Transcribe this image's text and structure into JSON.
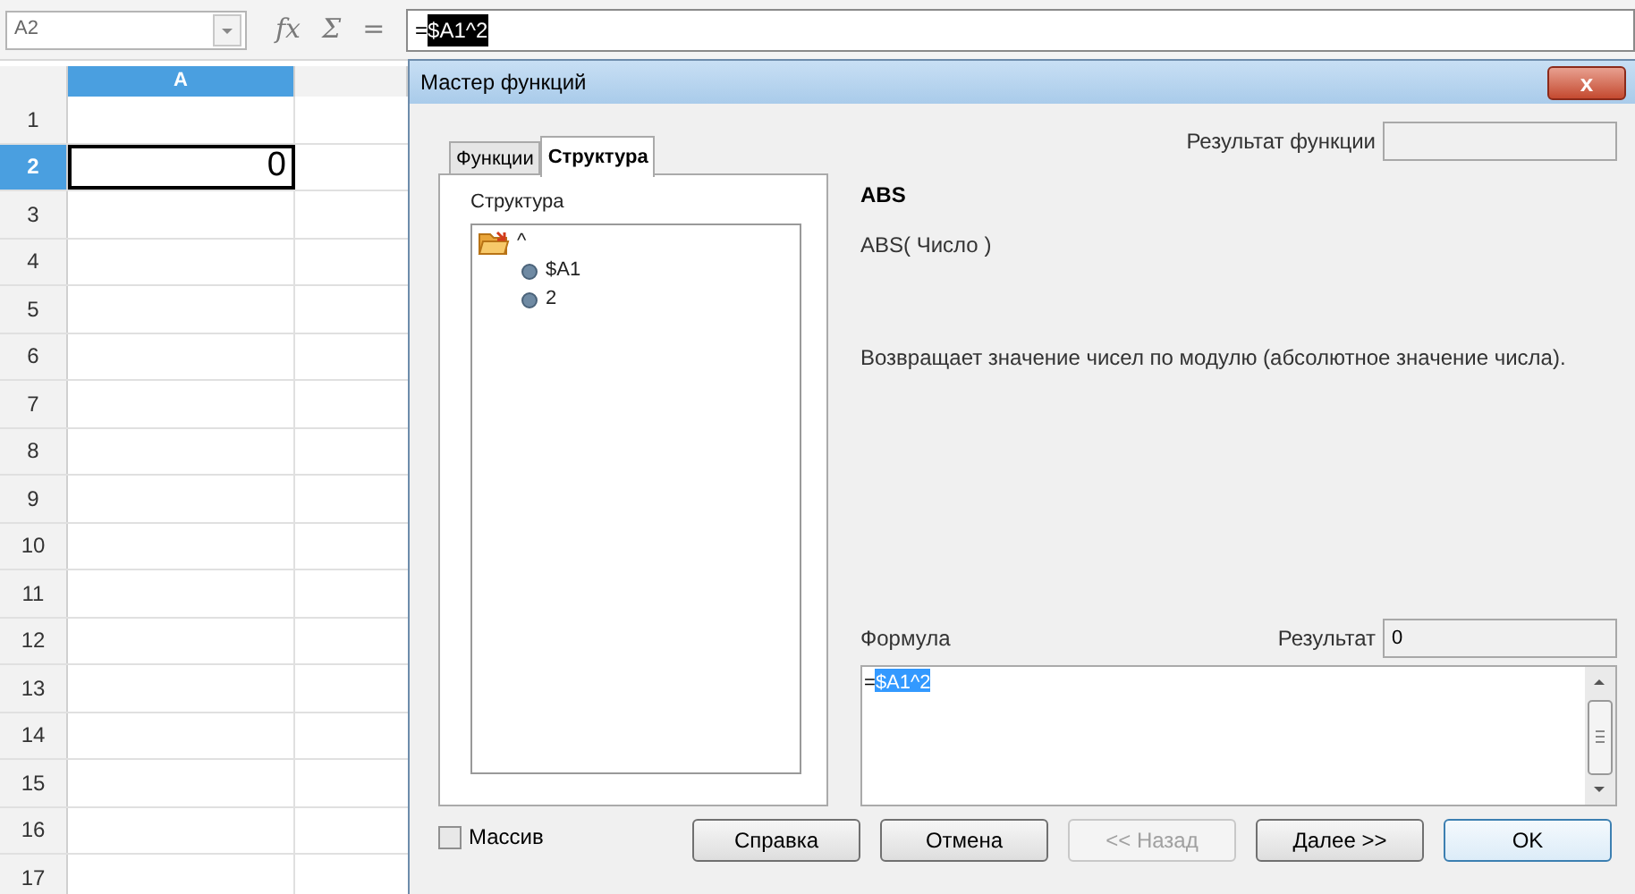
{
  "toolbar": {
    "name_box": "A2",
    "buttons": [
      {
        "label": "fx",
        "disabled": true
      },
      {
        "label": "Σ",
        "disabled": true
      },
      {
        "label": "=",
        "disabled": true
      }
    ],
    "formula_prefix": "=",
    "formula_selection": "$A1^2"
  },
  "sheet": {
    "columns": [
      {
        "label": "A",
        "selected": true
      },
      {
        "selected": false
      }
    ],
    "rows": [
      {
        "label": "1",
        "selected": false,
        "value": ""
      },
      {
        "label": "2",
        "selected": true,
        "value": "0"
      },
      {
        "label": "3",
        "selected": false,
        "value": ""
      },
      {
        "label": "4",
        "selected": false,
        "value": ""
      },
      {
        "label": "5",
        "selected": false,
        "value": ""
      },
      {
        "label": "6",
        "selected": false,
        "value": ""
      },
      {
        "label": "7",
        "selected": false,
        "value": ""
      },
      {
        "label": "8",
        "selected": false,
        "value": ""
      },
      {
        "label": "9",
        "selected": false,
        "value": ""
      },
      {
        "label": "10",
        "selected": false,
        "value": ""
      },
      {
        "label": "11",
        "selected": false,
        "value": ""
      },
      {
        "label": "12",
        "selected": false,
        "value": ""
      },
      {
        "label": "13",
        "selected": false,
        "value": ""
      },
      {
        "label": "14",
        "selected": false,
        "value": ""
      },
      {
        "label": "15",
        "selected": false,
        "value": ""
      },
      {
        "label": "16",
        "selected": false,
        "value": ""
      },
      {
        "label": "17",
        "selected": false,
        "value": ""
      }
    ]
  },
  "dialog": {
    "title": "Мастер функций",
    "close": "x",
    "tabs": [
      {
        "label": "Функции",
        "selected": false
      },
      {
        "label": "Структура",
        "selected": true
      }
    ],
    "structure_label": "Структура",
    "tree": [
      {
        "label": "^",
        "kind": "folder",
        "children": [
          {
            "label": "$A1",
            "kind": "leaf"
          },
          {
            "label": "2",
            "kind": "leaf"
          }
        ]
      }
    ],
    "function_result_label": "Результат функции",
    "function_name": "ABS",
    "function_signature": "ABS( Число )",
    "function_description": "Возвращает значение чисел по модулю (абсолютное значение числа).",
    "formula_label": "Формула",
    "result_label": "Результат",
    "result": "0",
    "formula_prefix": "=",
    "formula_selection": "$A1^2",
    "array_checkbox": {
      "label": "Массив",
      "checked": false
    },
    "buttons": [
      {
        "label": "Справка",
        "disabled": false,
        "default": false
      },
      {
        "label": "Отмена",
        "disabled": false,
        "default": false
      },
      {
        "label": "<< Назад",
        "disabled": true,
        "default": false
      },
      {
        "label": "Далее >>",
        "disabled": false,
        "default": false
      },
      {
        "label": "OK",
        "disabled": false,
        "default": true
      }
    ]
  }
}
